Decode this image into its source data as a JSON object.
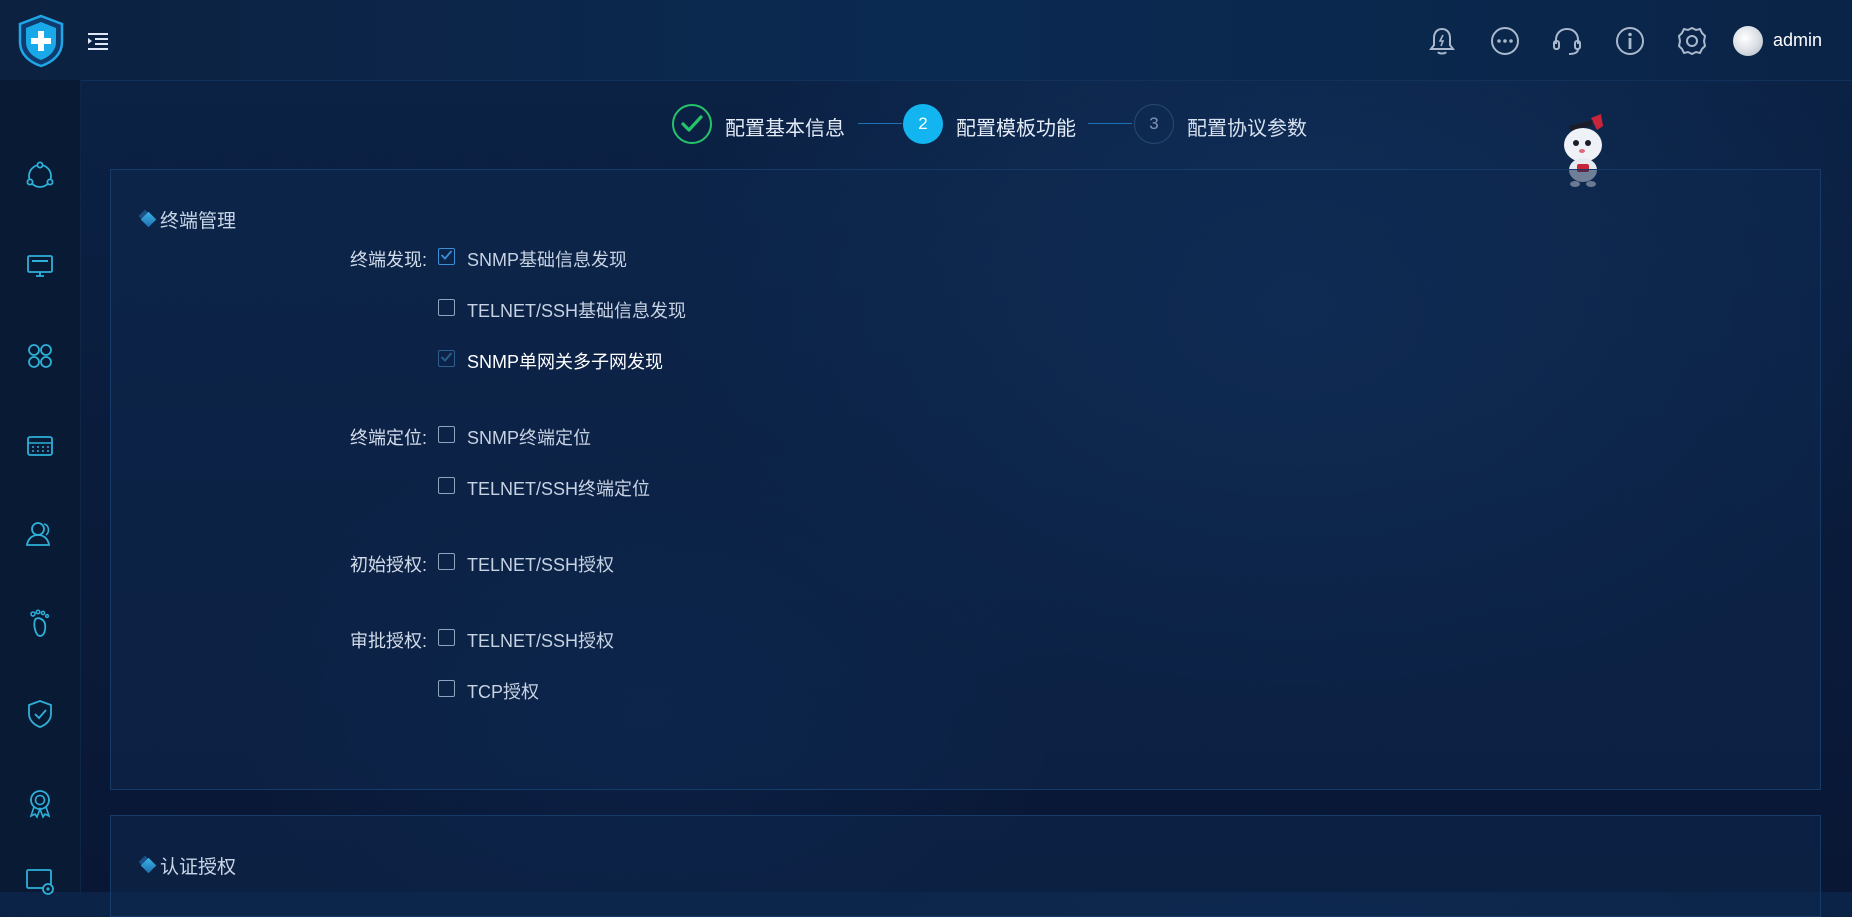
{
  "header": {
    "username": "admin",
    "icons": [
      "shield-plus-logo",
      "menu-indent-icon",
      "bell-icon",
      "more-icon",
      "headset-icon",
      "info-icon",
      "settings-icon"
    ]
  },
  "sidebar": {
    "icons": [
      "topology-icon",
      "monitor-icon",
      "apps-icon",
      "keyboard-icon",
      "user-icon",
      "footprint-icon",
      "shield-check-icon",
      "award-icon",
      "screen-settings-icon"
    ]
  },
  "steps": [
    {
      "number": "",
      "label": "配置基本信息",
      "status": "done"
    },
    {
      "number": "2",
      "label": "配置模板功能",
      "status": "active"
    },
    {
      "number": "3",
      "label": "配置协议参数",
      "status": "pending"
    }
  ],
  "terminal_management": {
    "title": "终端管理",
    "discovery_label": "终端发现:",
    "discovery_options": [
      {
        "label": "SNMP基础信息发现",
        "checked": true
      },
      {
        "label": "TELNET/SSH基础信息发现",
        "checked": false
      },
      {
        "label": "SNMP单网关多子网发现",
        "checked": true
      }
    ],
    "location_label": "终端定位:",
    "location_options": [
      {
        "label": "SNMP终端定位",
        "checked": false
      },
      {
        "label": "TELNET/SSH终端定位",
        "checked": false
      }
    ],
    "initial_auth_label": "初始授权:",
    "initial_auth_options": [
      {
        "label": "TELNET/SSH授权",
        "checked": false
      }
    ],
    "approval_auth_label": "审批授权:",
    "approval_auth_options": [
      {
        "label": "TELNET/SSH授权",
        "checked": false
      },
      {
        "label": "TCP授权",
        "checked": false
      }
    ]
  },
  "auth_section": {
    "title": "认证授权"
  },
  "colors": {
    "accent": "#12b5f0",
    "success": "#25c46b",
    "background": "#0a1d3a"
  }
}
